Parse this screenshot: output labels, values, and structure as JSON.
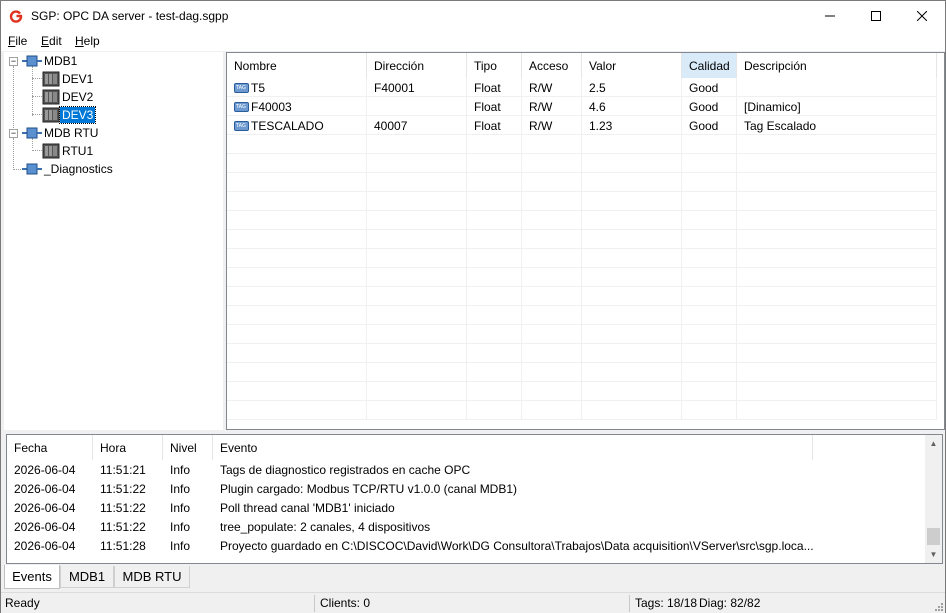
{
  "window": {
    "title": "SGP: OPC DA server - test-dag.sgpp",
    "app_icon": "g-logo-icon",
    "controls": [
      "minimize-icon",
      "maximize-icon",
      "close-icon"
    ]
  },
  "menu": {
    "items": [
      "File",
      "Edit",
      "Help"
    ],
    "mnemonics": [
      "F",
      "E",
      "H"
    ],
    "rests": [
      "ile",
      "dit",
      "elp"
    ]
  },
  "tree": {
    "nodes": [
      {
        "label": "MDB1",
        "icon": "channel-icon",
        "expanded": true
      },
      {
        "label": "DEV1",
        "icon": "device-icon"
      },
      {
        "label": "DEV2",
        "icon": "device-icon"
      },
      {
        "label": "DEV3",
        "icon": "device-icon",
        "selected": true
      },
      {
        "label": "MDB RTU",
        "icon": "channel-icon",
        "expanded": true
      },
      {
        "label": "RTU1",
        "icon": "device-icon"
      },
      {
        "label": "_Diagnostics",
        "icon": "channel-icon"
      }
    ]
  },
  "tags_grid": {
    "columns": [
      "Nombre",
      "Dirección",
      "Tipo",
      "Acceso",
      "Valor",
      "Calidad",
      "Descripción"
    ],
    "sorted_column": "Calidad",
    "rows": [
      [
        "T5",
        "F40001",
        "Float",
        "R/W",
        "2.5",
        "Good",
        ""
      ],
      [
        "F40003",
        "",
        "Float",
        "R/W",
        "4.6",
        "Good",
        "[Dinamico]"
      ],
      [
        "TESCALADO",
        "40007",
        "Float",
        "R/W",
        "1.23",
        "Good",
        "Tag Escalado"
      ]
    ]
  },
  "events": {
    "columns": [
      "Fecha",
      "Hora",
      "Nivel",
      "Evento"
    ],
    "rows": [
      [
        "2026-06-04",
        "11:51:21",
        "Info",
        "Tags de diagnostico registrados en cache OPC"
      ],
      [
        "2026-06-04",
        "11:51:22",
        "Info",
        "Plugin cargado: Modbus TCP/RTU v1.0.0 (canal MDB1)"
      ],
      [
        "2026-06-04",
        "11:51:22",
        "Info",
        "Poll thread canal 'MDB1' iniciado"
      ],
      [
        "2026-06-04",
        "11:51:22",
        "Info",
        "tree_populate: 2 canales, 4 dispositivos"
      ],
      [
        "2026-06-04",
        "11:51:28",
        "Info",
        "Proyecto guardado en C:\\DISCOC\\David\\Work\\DG Consultora\\Trabajos\\Data acquisition\\VServer\\src\\sgp.loca..."
      ]
    ]
  },
  "bottom_tabs": {
    "items": [
      "Events",
      "MDB1",
      "MDB RTU"
    ],
    "active": "Events"
  },
  "status": {
    "ready": "Ready",
    "clients": "Clients: 0",
    "tags": "Tags: 18/18",
    "diag": "Diag: 82/82"
  },
  "colors": {
    "selection": "#0078d7",
    "sorted_header": "#d9ebf9",
    "logo_red": "#e0301e"
  }
}
